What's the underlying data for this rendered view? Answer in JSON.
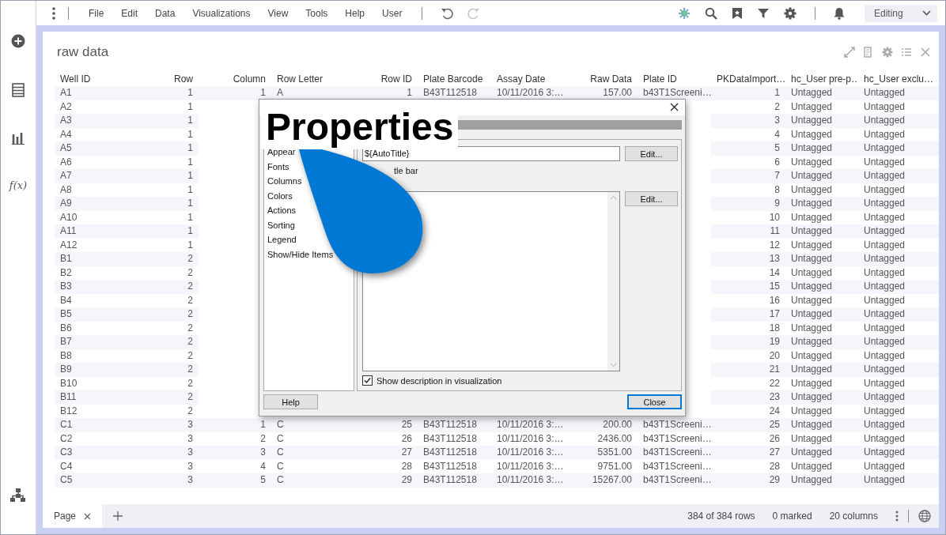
{
  "toolbar": {
    "menu": [
      "File",
      "Edit",
      "Data",
      "Visualizations",
      "View",
      "Tools",
      "Help",
      "User"
    ],
    "history_buttons": [
      {
        "disabled": false
      },
      {
        "disabled": true
      }
    ],
    "mode_dropdown": {
      "value": "Editing"
    }
  },
  "sidebar": {
    "formula_label": "f(x)"
  },
  "panel": {
    "title": "raw data"
  },
  "table": {
    "columns": [
      {
        "label": "Well ID",
        "kind": "text"
      },
      {
        "label": "Row",
        "kind": "number"
      },
      {
        "label": "Column",
        "kind": "number"
      },
      {
        "label": "Row Letter",
        "kind": "text"
      },
      {
        "label": "Row ID",
        "kind": "number"
      },
      {
        "label": "Plate Barcode",
        "kind": "text"
      },
      {
        "label": "Assay Date",
        "kind": "text"
      },
      {
        "label": "Raw Data",
        "kind": "number"
      },
      {
        "label": "Plate ID",
        "kind": "text"
      },
      {
        "label": "PKDataImport…",
        "kind": "number"
      },
      {
        "label": "hc_User pre-p…",
        "kind": "text"
      },
      {
        "label": "hc_User exclu…",
        "kind": "text"
      }
    ],
    "rows": [
      [
        "A1",
        "1",
        "1",
        "A",
        "1",
        "B43T112518",
        "10/11/2016 3:…",
        "157.00",
        "b43T1Screeni…",
        "1",
        "Untagged",
        "Untagged"
      ],
      [
        "A2",
        "1",
        null,
        null,
        null,
        null,
        null,
        null,
        null,
        "2",
        "Untagged",
        "Untagged"
      ],
      [
        "A3",
        "1",
        null,
        null,
        null,
        null,
        null,
        null,
        null,
        "3",
        "Untagged",
        "Untagged"
      ],
      [
        "A4",
        "1",
        null,
        null,
        null,
        null,
        null,
        null,
        null,
        "4",
        "Untagged",
        "Untagged"
      ],
      [
        "A5",
        "1",
        null,
        null,
        null,
        null,
        null,
        null,
        null,
        "5",
        "Untagged",
        "Untagged"
      ],
      [
        "A6",
        "1",
        null,
        null,
        null,
        null,
        null,
        null,
        null,
        "6",
        "Untagged",
        "Untagged"
      ],
      [
        "A7",
        "1",
        null,
        null,
        null,
        null,
        null,
        null,
        null,
        "7",
        "Untagged",
        "Untagged"
      ],
      [
        "A8",
        "1",
        null,
        null,
        null,
        null,
        null,
        null,
        null,
        "8",
        "Untagged",
        "Untagged"
      ],
      [
        "A9",
        "1",
        null,
        null,
        null,
        null,
        null,
        null,
        null,
        "9",
        "Untagged",
        "Untagged"
      ],
      [
        "A10",
        "1",
        null,
        null,
        null,
        null,
        null,
        null,
        null,
        "10",
        "Untagged",
        "Untagged"
      ],
      [
        "A11",
        "1",
        null,
        null,
        null,
        null,
        null,
        null,
        null,
        "11",
        "Untagged",
        "Untagged"
      ],
      [
        "A12",
        "1",
        null,
        null,
        null,
        null,
        null,
        null,
        null,
        "12",
        "Untagged",
        "Untagged"
      ],
      [
        "B1",
        "2",
        null,
        null,
        null,
        null,
        null,
        null,
        null,
        "13",
        "Untagged",
        "Untagged"
      ],
      [
        "B2",
        "2",
        null,
        null,
        null,
        null,
        null,
        null,
        null,
        "14",
        "Untagged",
        "Untagged"
      ],
      [
        "B3",
        "2",
        null,
        null,
        null,
        null,
        null,
        null,
        null,
        "15",
        "Untagged",
        "Untagged"
      ],
      [
        "B4",
        "2",
        null,
        null,
        null,
        null,
        null,
        null,
        null,
        "16",
        "Untagged",
        "Untagged"
      ],
      [
        "B5",
        "2",
        null,
        null,
        null,
        null,
        null,
        null,
        null,
        "17",
        "Untagged",
        "Untagged"
      ],
      [
        "B6",
        "2",
        null,
        null,
        null,
        null,
        null,
        null,
        null,
        "18",
        "Untagged",
        "Untagged"
      ],
      [
        "B7",
        "2",
        null,
        null,
        null,
        null,
        null,
        null,
        null,
        "19",
        "Untagged",
        "Untagged"
      ],
      [
        "B8",
        "2",
        null,
        null,
        null,
        null,
        null,
        null,
        null,
        "20",
        "Untagged",
        "Untagged"
      ],
      [
        "B9",
        "2",
        null,
        null,
        null,
        null,
        null,
        null,
        null,
        "21",
        "Untagged",
        "Untagged"
      ],
      [
        "B10",
        "2",
        null,
        null,
        null,
        null,
        null,
        null,
        null,
        "22",
        "Untagged",
        "Untagged"
      ],
      [
        "B11",
        "2",
        null,
        null,
        null,
        null,
        null,
        null,
        null,
        "23",
        "Untagged",
        "Untagged"
      ],
      [
        "B12",
        "2",
        null,
        null,
        null,
        null,
        null,
        null,
        null,
        "24",
        "Untagged",
        "Untagged"
      ],
      [
        "C1",
        "3",
        "1",
        "C",
        "25",
        "B43T112518",
        "10/11/2016 3:…",
        "200.00",
        "b43T1Screeni…",
        "25",
        "Untagged",
        "Untagged"
      ],
      [
        "C2",
        "3",
        "2",
        "C",
        "26",
        "B43T112518",
        "10/11/2016 3:…",
        "2436.00",
        "b43T1Screeni…",
        "26",
        "Untagged",
        "Untagged"
      ],
      [
        "C3",
        "3",
        "3",
        "C",
        "27",
        "B43T112518",
        "10/11/2016 3:…",
        "5351.00",
        "b43T1Screeni…",
        "27",
        "Untagged",
        "Untagged"
      ],
      [
        "C4",
        "3",
        "4",
        "C",
        "28",
        "B43T112518",
        "10/11/2016 3:…",
        "9751.00",
        "b43T1Screeni…",
        "28",
        "Untagged",
        "Untagged"
      ],
      [
        "C5",
        "3",
        "5",
        "C",
        "29",
        "B43T112518",
        "10/11/2016 3:…",
        "15267.00",
        "b43T1Screeni…",
        "29",
        "Untagged",
        "Untagged"
      ]
    ]
  },
  "dialog": {
    "nav_items": [
      "Appear",
      "Fonts",
      "Columns",
      "Colors",
      "Actions",
      "Sorting",
      "Legend",
      "Show/Hide Items"
    ],
    "title_field": {
      "value": "${AutoTitle}"
    },
    "title_bar_option_label": "tle bar",
    "edit_buttons": [
      "Edit...",
      "Edit..."
    ],
    "show_description": {
      "label": "Show description in visualization",
      "checked": true
    },
    "help_button": "Help",
    "close_button": "Close"
  },
  "callout": {
    "label": "Properties"
  },
  "footer": {
    "tabs": [
      {
        "label": "Page",
        "selected": true
      }
    ],
    "row_count": "384 of 384 rows",
    "marked": "0 marked",
    "column_count": "20 columns"
  }
}
